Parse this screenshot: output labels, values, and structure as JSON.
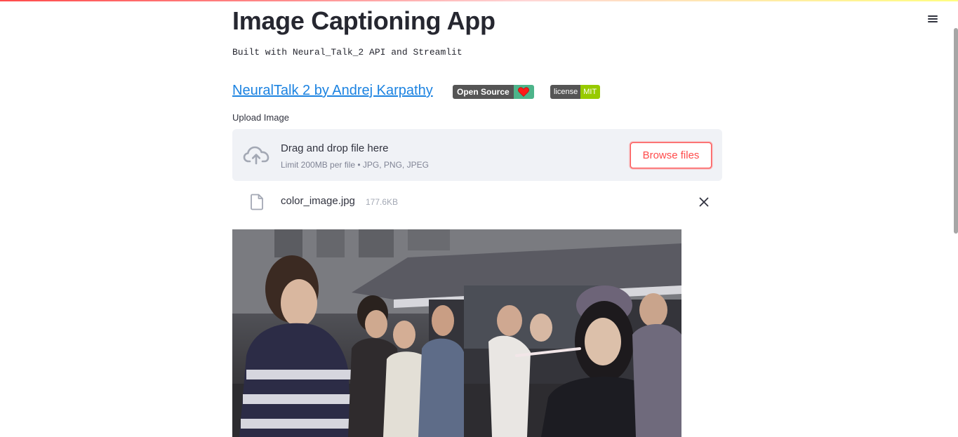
{
  "app": {
    "title": "Image Captioning App",
    "subtitle": "Built with Neural_Talk_2 API and Streamlit"
  },
  "links": {
    "neuraltalk": "NeuralTalk 2 by Andrej Karpathy"
  },
  "badges": {
    "open_source": {
      "label": "Open Source",
      "icon": "heart-icon"
    },
    "license": {
      "label": "license",
      "value": "MIT"
    }
  },
  "uploader": {
    "label": "Upload Image",
    "drop_title": "Drag and drop file here",
    "drop_subtitle": "Limit 200MB per file • JPG, PNG, JPEG",
    "browse_label": "Browse files"
  },
  "uploaded_file": {
    "name": "color_image.jpg",
    "size": "177.6KB"
  },
  "colors": {
    "accent": "#ff4b4b",
    "link": "#1c83e1",
    "dropzone_bg": "#f0f2f6",
    "badge_dark": "#555555",
    "badge_green": "#4db48a",
    "badge_mit": "#97ca00"
  },
  "icons": {
    "menu": "hamburger-menu-icon",
    "upload": "cloud-upload-icon",
    "file": "file-icon",
    "remove": "close-icon"
  }
}
